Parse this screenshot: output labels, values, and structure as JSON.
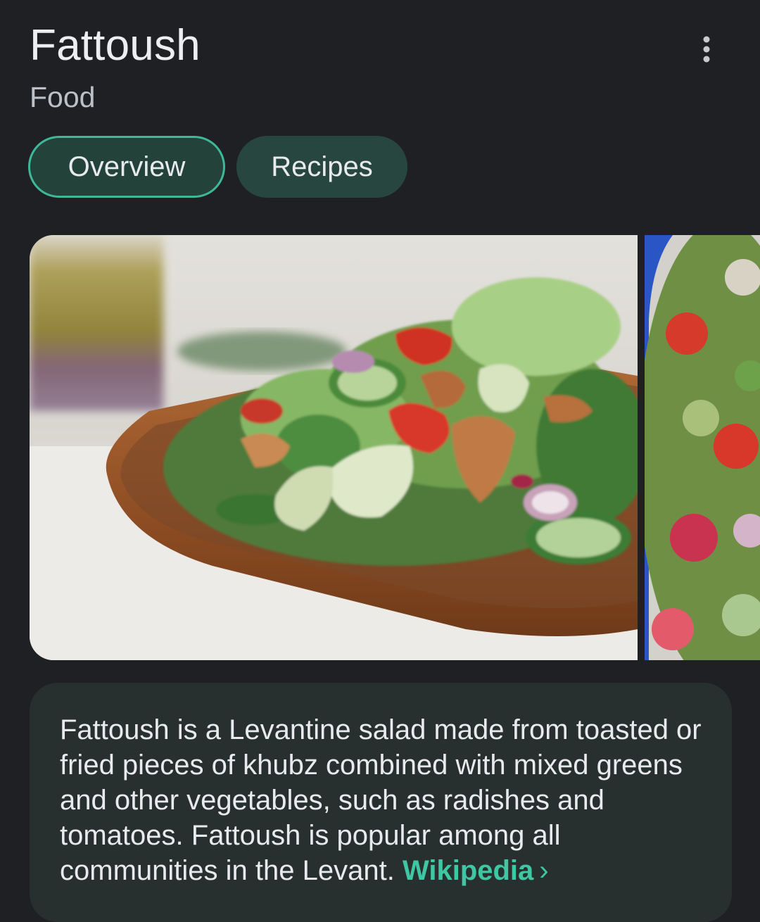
{
  "header": {
    "title": "Fattoush",
    "subtitle": "Food"
  },
  "tabs": [
    {
      "label": "Overview",
      "active": true
    },
    {
      "label": "Recipes",
      "active": false
    }
  ],
  "description": {
    "text": "Fattoush is a Levantine salad made from toasted or fried pieces of khubz combined with mixed greens and other vegetables, such as radishes and tomatoes. Fattoush is popular among all communities in the Levant.",
    "source_link": "Wikipedia",
    "source_chevron": "›"
  },
  "colors": {
    "background": "#1f2023",
    "accent": "#3fc6a2",
    "chip_background": "#284640",
    "card_background": "#27302f"
  },
  "icons": {
    "more": "more-vert-icon",
    "chevron": "chevron-right-icon"
  }
}
